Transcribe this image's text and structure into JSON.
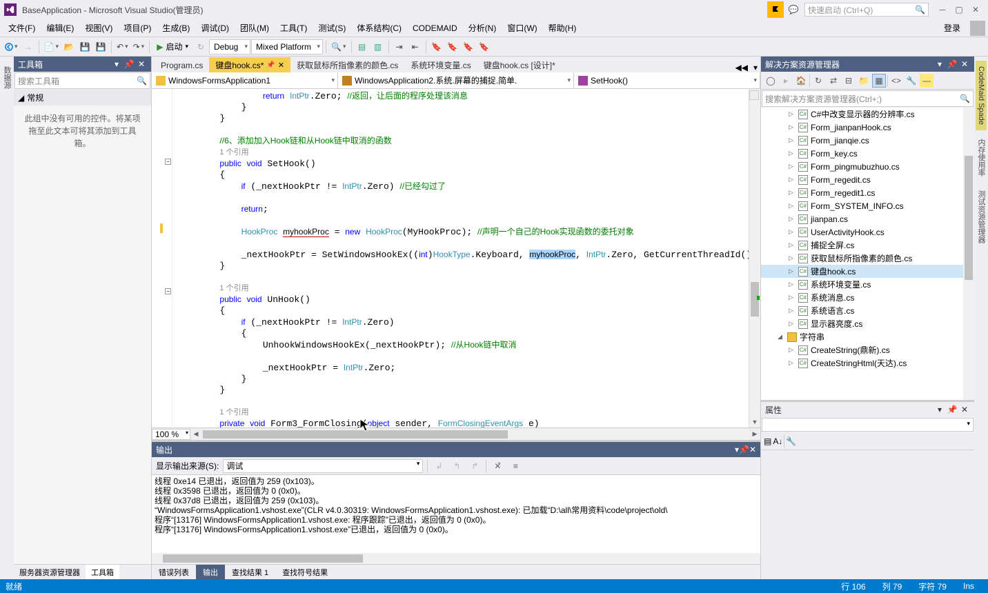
{
  "title": "BaseApplication - Microsoft Visual Studio(管理员)",
  "quicklaunch_placeholder": "快速启动 (Ctrl+Q)",
  "menu": [
    "文件(F)",
    "编辑(E)",
    "视图(V)",
    "项目(P)",
    "生成(B)",
    "调试(D)",
    "团队(M)",
    "工具(T)",
    "测试(S)",
    "体系结构(C)",
    "CODEMAID",
    "分析(N)",
    "窗口(W)",
    "帮助(H)"
  ],
  "login": "登录",
  "toolbar": {
    "start": "启动",
    "config": "Debug",
    "platform": "Mixed Platform"
  },
  "left_margin_tabs": [
    "数据源"
  ],
  "toolbox": {
    "title": "工具箱",
    "search": "搜索工具箱",
    "category": "常规",
    "empty": "此组中没有可用的控件。将某项拖至此文本可将其添加到工具箱。"
  },
  "left_tabs": [
    "服务器资源管理器",
    "工具箱"
  ],
  "doc_tabs": [
    {
      "label": "Program.cs",
      "active": false
    },
    {
      "label": "键盘hook.cs*",
      "active": true,
      "pinned": true
    },
    {
      "label": "获取鼠标所指像素的颜色.cs",
      "active": false
    },
    {
      "label": "系统环境变量.cs",
      "active": false
    },
    {
      "label": "键盘hook.cs [设计]*",
      "active": false
    }
  ],
  "nav": {
    "project": "WindowsFormsApplication1",
    "class": "WindowsApplication2.系统.屏幕的捕捉.简单.",
    "member": "SetHook()"
  },
  "refs": "1 个引用",
  "zoom": "100 %",
  "output": {
    "title": "输出",
    "source_label": "显示输出来源(S):",
    "source_value": "调试",
    "lines": [
      "线程 0xe14 已退出，返回值为 259 (0x103)。",
      "线程 0x3598 已退出，返回值为 0 (0x0)。",
      "线程 0x37d8 已退出，返回值为 259 (0x103)。",
      "“WindowsFormsApplication1.vshost.exe”(CLR v4.0.30319: WindowsFormsApplication1.vshost.exe): 已加载“D:\\all\\常用资料\\code\\project\\old\\",
      "程序“[13176] WindowsFormsApplication1.vshost.exe: 程序跟踪”已退出，返回值为 0 (0x0)。",
      "程序“[13176] WindowsFormsApplication1.vshost.exe”已退出，返回值为 0 (0x0)。"
    ]
  },
  "bottom_tabs": [
    "错误列表",
    "输出",
    "查找结果 1",
    "查找符号结果"
  ],
  "solution": {
    "title": "解决方案资源管理器",
    "search": "搜索解决方案资源管理器(Ctrl+;)",
    "items": [
      {
        "label": "C#中改变显示器的分辨率.cs"
      },
      {
        "label": "Form_jianpanHook.cs"
      },
      {
        "label": "Form_jianqie.cs"
      },
      {
        "label": "Form_key.cs"
      },
      {
        "label": "Form_pingmubuzhuo.cs"
      },
      {
        "label": "Form_regedit.cs"
      },
      {
        "label": "Form_regedit1.cs"
      },
      {
        "label": "Form_SYSTEM_INFO.cs"
      },
      {
        "label": "jianpan.cs"
      },
      {
        "label": "UserActivityHook.cs"
      },
      {
        "label": "捕捉全屏.cs"
      },
      {
        "label": "获取鼠标所指像素的颜色.cs"
      },
      {
        "label": "键盘hook.cs",
        "sel": true
      },
      {
        "label": "系统环境变量.cs"
      },
      {
        "label": "系统消息.cs"
      },
      {
        "label": "系统语言.cs"
      },
      {
        "label": "显示器亮度.cs"
      },
      {
        "label": "字符串",
        "folder": true,
        "indent": -1
      },
      {
        "label": "CreateString(鼎新).cs"
      },
      {
        "label": "CreateStringHtml(天达).cs"
      }
    ]
  },
  "properties": {
    "title": "属性"
  },
  "right_margin_tabs": [
    "CodeMaid Spade",
    "内存使用率",
    "测试资源管理器"
  ],
  "status": {
    "ready": "就绪",
    "line": "行 106",
    "col": "列 79",
    "ch": "字符 79",
    "ins": "Ins"
  }
}
